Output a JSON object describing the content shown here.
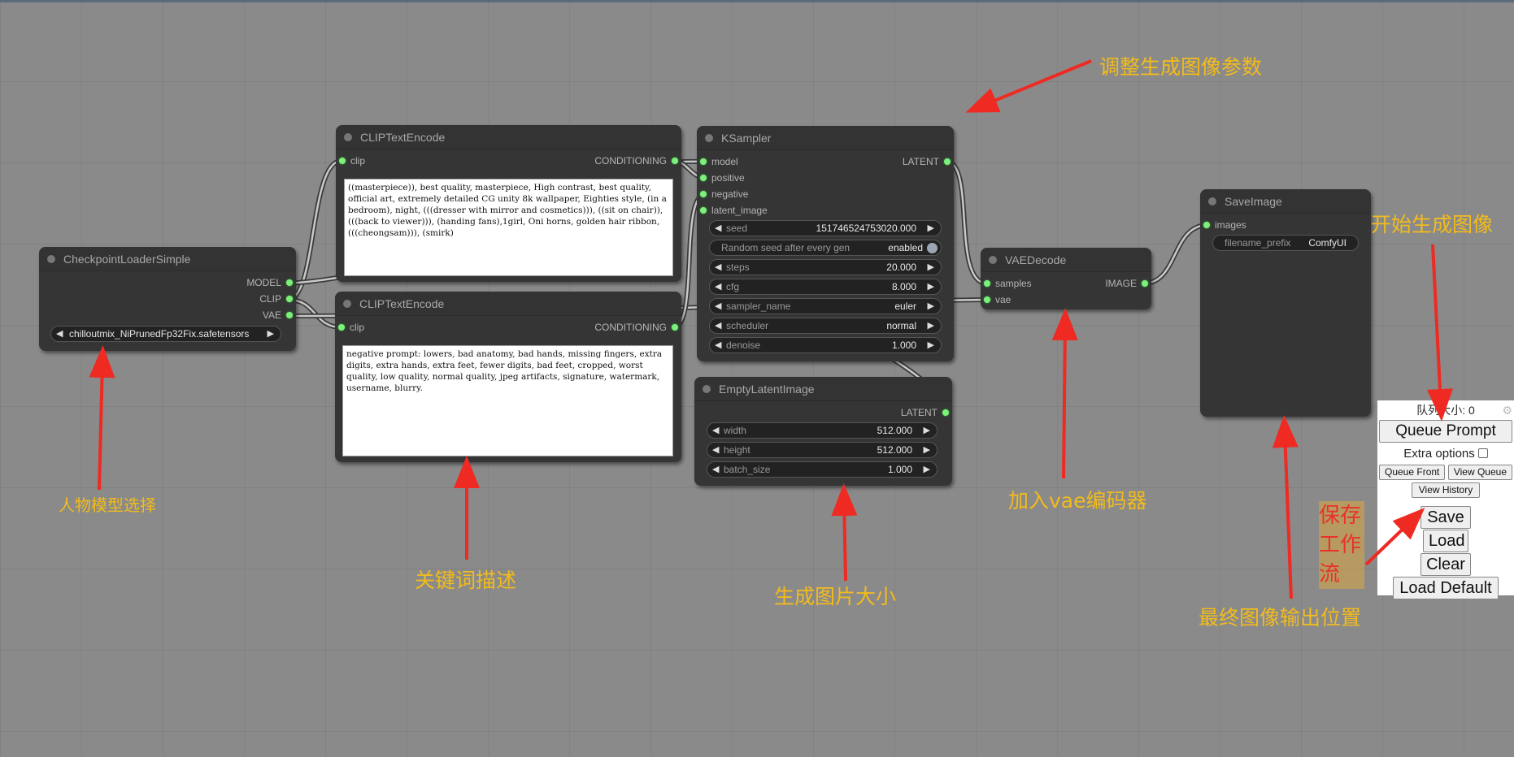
{
  "nodes": {
    "checkpoint": {
      "title": "CheckpointLoaderSimple",
      "outputs": [
        "MODEL",
        "CLIP",
        "VAE"
      ],
      "ckpt_name": "chilloutmix_NiPrunedFp32Fix.safetensors"
    },
    "clip_positive": {
      "title": "CLIPTextEncode",
      "input": "clip",
      "output": "CONDITIONING",
      "text": "((masterpiece)), best quality, masterpiece, High contrast, best quality, official art, extremely detailed CG unity 8k wallpaper, Eighties style, (in a bedroom), night, (((dresser with mirror and cosmetics))), ((sit on chair)), (((back to viewer))), (handing fans),1girl, Oni horns, golden hair ribbon, (((cheongsam))), (smirk)"
    },
    "clip_negative": {
      "title": "CLIPTextEncode",
      "input": "clip",
      "output": "CONDITIONING",
      "text": "negative prompt: lowers, bad anatomy, bad hands, missing fingers, extra digits, extra hands, extra feet, fewer digits, bad feet, cropped, worst quality, low quality, normal quality, jpeg artifacts, signature, watermark, username, blurry."
    },
    "ksampler": {
      "title": "KSampler",
      "inputs": [
        "model",
        "positive",
        "negative",
        "latent_image"
      ],
      "output": "LATENT",
      "widgets": {
        "seed": {
          "label": "seed",
          "value": "151746524753020.000"
        },
        "random_seed": {
          "label": "Random seed after every gen",
          "value": "enabled"
        },
        "steps": {
          "label": "steps",
          "value": "20.000"
        },
        "cfg": {
          "label": "cfg",
          "value": "8.000"
        },
        "sampler_name": {
          "label": "sampler_name",
          "value": "euler"
        },
        "scheduler": {
          "label": "scheduler",
          "value": "normal"
        },
        "denoise": {
          "label": "denoise",
          "value": "1.000"
        }
      }
    },
    "empty_latent": {
      "title": "EmptyLatentImage",
      "output": "LATENT",
      "widgets": {
        "width": {
          "label": "width",
          "value": "512.000"
        },
        "height": {
          "label": "height",
          "value": "512.000"
        },
        "batch_size": {
          "label": "batch_size",
          "value": "1.000"
        }
      }
    },
    "vae_decode": {
      "title": "VAEDecode",
      "inputs": [
        "samples",
        "vae"
      ],
      "output": "IMAGE"
    },
    "save_image": {
      "title": "SaveImage",
      "input": "images",
      "filename_prefix": {
        "label": "filename_prefix",
        "value": "ComfyUI"
      }
    }
  },
  "menu": {
    "queue_size": "队列大小: 0",
    "queue_prompt": "Queue Prompt",
    "extra_options": "Extra options",
    "extra_options_checked": false,
    "queue_front": "Queue Front",
    "view_queue": "View Queue",
    "view_history": "View History",
    "save": "Save",
    "load": "Load",
    "clear": "Clear",
    "load_default": "Load Default"
  },
  "annotations": {
    "model_select": "人物模型选择",
    "keywords": "关键词描述",
    "image_size": "生成图片大小",
    "adjust_params": "调整生成图像参数",
    "add_vae": "加入vae编码器",
    "output_location": "最终图像输出位置",
    "start_generate": "开始生成图像",
    "save_workflow": "保存工作流"
  },
  "colors": {
    "canvas": "#8a8a8a",
    "node_bg": "#353535",
    "slot_pin": "#7cf07c",
    "annotation_text": "#f2bb1c",
    "arrow": "#ee2a22"
  }
}
